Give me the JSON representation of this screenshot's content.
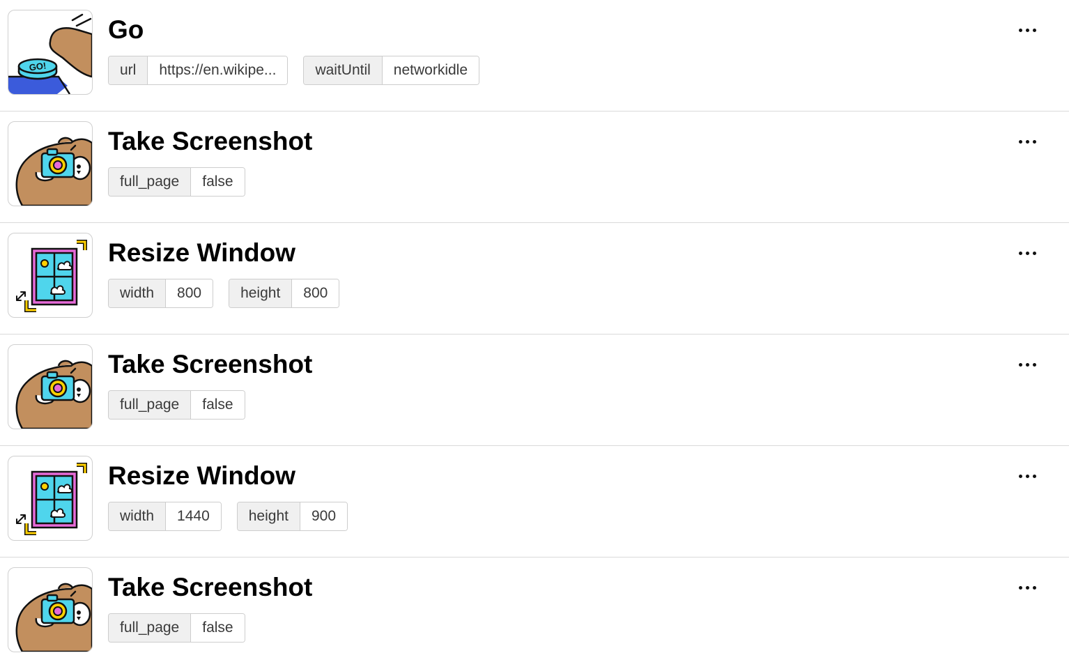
{
  "steps": [
    {
      "icon": "go-button-icon",
      "title": "Go",
      "params": [
        {
          "key": "url",
          "value": "https://en.wikipe..."
        },
        {
          "key": "waitUntil",
          "value": "networkidle"
        }
      ]
    },
    {
      "icon": "screenshot-camera-icon",
      "title": "Take Screenshot",
      "params": [
        {
          "key": "full_page",
          "value": "false"
        }
      ]
    },
    {
      "icon": "resize-window-icon",
      "title": "Resize Window",
      "params": [
        {
          "key": "width",
          "value": "800"
        },
        {
          "key": "height",
          "value": "800"
        }
      ]
    },
    {
      "icon": "screenshot-camera-icon",
      "title": "Take Screenshot",
      "params": [
        {
          "key": "full_page",
          "value": "false"
        }
      ]
    },
    {
      "icon": "resize-window-icon",
      "title": "Resize Window",
      "params": [
        {
          "key": "width",
          "value": "1440"
        },
        {
          "key": "height",
          "value": "900"
        }
      ]
    },
    {
      "icon": "screenshot-camera-icon",
      "title": "Take Screenshot",
      "params": [
        {
          "key": "full_page",
          "value": "false"
        }
      ]
    }
  ],
  "go_icon_text": "GO!",
  "more_icon": "more-options-icon",
  "colors": {
    "bear": "#c28f5e",
    "camera": "#4fd5ec",
    "go_blue": "#3b5bdb",
    "window_frame": "#e66ad8",
    "accent_yellow": "#ffd000"
  }
}
